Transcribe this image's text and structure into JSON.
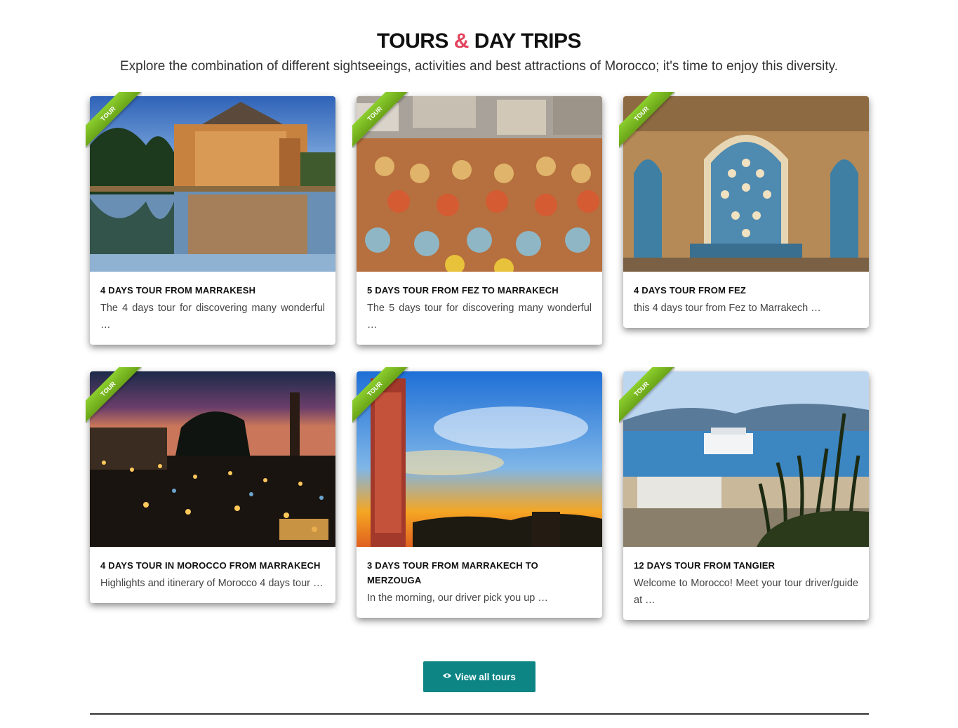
{
  "section": {
    "heading_part1": "TOURS",
    "heading_amp": "&",
    "heading_part2": "DAY TRIPS",
    "subheading": "Explore the combination of different sightseeings, activities and best attractions of Morocco; it's time to enjoy this diversity."
  },
  "ribbon_label": "TOUR",
  "tours": [
    {
      "title": "4 DAYS TOUR FROM MARRAKESH",
      "excerpt": "The 4 days tour for discovering many wonderful …",
      "image_icon": "menara-pavilion-image"
    },
    {
      "title": "5 DAYS TOUR FROM FEZ TO MARRAKECH",
      "excerpt": "The 5 days tour for discovering many wonderful …",
      "image_icon": "fez-tannery-image"
    },
    {
      "title": "4 DAYS TOUR FROM FEZ",
      "excerpt": "this 4 days tour from Fez to Marrakech …",
      "image_icon": "mosaic-fountain-image"
    },
    {
      "title": "4 DAYS TOUR IN MOROCCO FROM MARRAKECH",
      "excerpt": "Highlights and itinerary of Morocco 4 days tour …",
      "image_icon": "night-market-image"
    },
    {
      "title": "3 DAYS TOUR FROM MARRAKECH TO MERZOUGA",
      "excerpt": "In the morning, our driver pick you up …",
      "image_icon": "koutoubia-sunset-image"
    },
    {
      "title": "12 DAYS TOUR FROM TANGIER",
      "excerpt": "Welcome to Morocco! Meet your tour driver/guide at …",
      "image_icon": "tangier-port-image"
    }
  ],
  "button": {
    "label": "View all tours",
    "icon": "eye-icon"
  },
  "colors": {
    "accent": "#e2445c",
    "button": "#0e8585",
    "ribbon": "#7cbb22"
  }
}
